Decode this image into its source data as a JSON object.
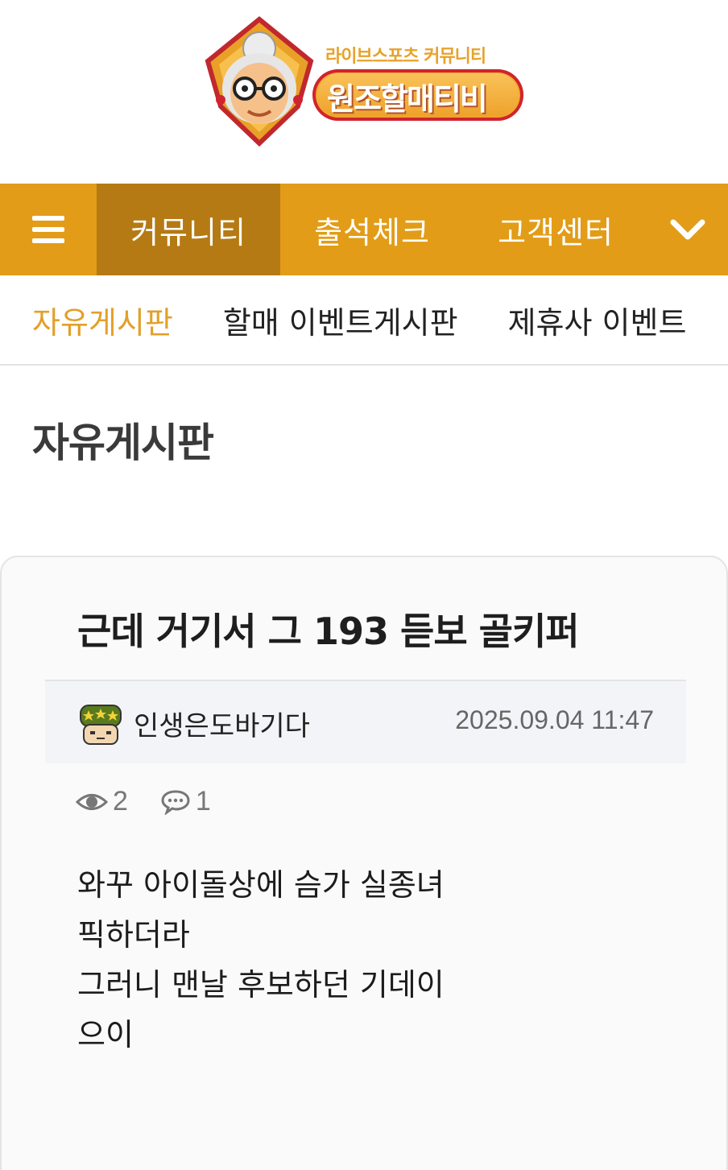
{
  "logo": {
    "subtitle": "라이브스포츠 커뮤니티",
    "name": "원조할매티비"
  },
  "main_nav": {
    "items": [
      {
        "label": "커뮤니티",
        "active": true
      },
      {
        "label": "출석체크",
        "active": false
      },
      {
        "label": "고객센터",
        "active": false
      }
    ],
    "menu_icon": "hamburger-icon",
    "more_icon": "chevron-down-icon"
  },
  "sub_nav": {
    "items": [
      {
        "label": "자유게시판",
        "active": true
      },
      {
        "label": "할매 이벤트게시판",
        "active": false
      },
      {
        "label": "제휴사 이벤트",
        "active": false
      }
    ]
  },
  "board": {
    "title": "자유게시판"
  },
  "post": {
    "title": "근데 거기서 그 193 듣보 골키퍼",
    "author": "인생은도바기다",
    "date": "2025.09.04 11:47",
    "views": "2",
    "comments": "1",
    "body_lines": [
      "와꾸 아이돌상에 슴가 실종녀",
      "픽하더라",
      "",
      "그러니 맨날 후보하던 기데이",
      "으이"
    ]
  },
  "colors": {
    "brand_orange": "#e29c17",
    "active_nav": "#b57a13",
    "active_sub": "#e2a02a"
  }
}
